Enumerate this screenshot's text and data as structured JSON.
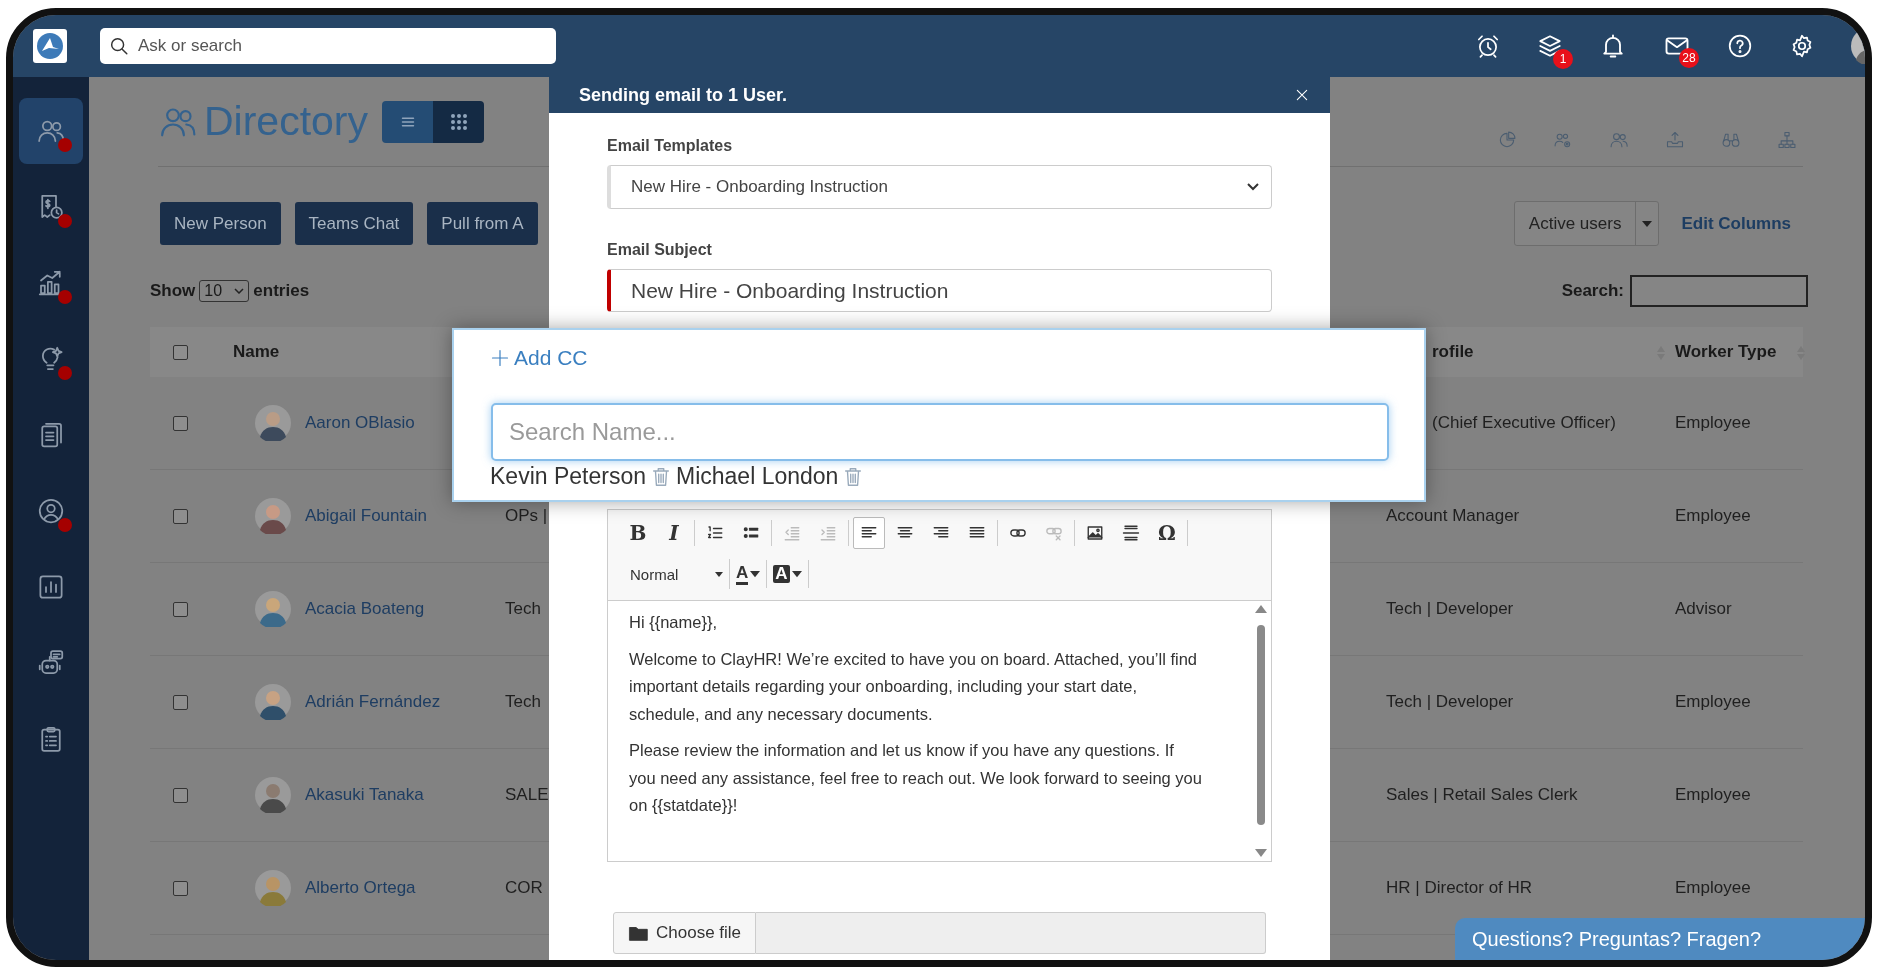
{
  "topbar": {
    "search": {
      "placeholder": "Ask or search"
    },
    "layers_badge": "1",
    "mail_badge": "28"
  },
  "sidebar": {
    "items": [
      {
        "selected": true,
        "alert": true
      },
      {
        "selected": false,
        "alert": true
      },
      {
        "selected": false,
        "alert": true
      },
      {
        "selected": false,
        "alert": true
      },
      {
        "selected": false,
        "alert": false
      },
      {
        "selected": false,
        "alert": true
      },
      {
        "selected": false,
        "alert": false
      },
      {
        "selected": false,
        "alert": false
      },
      {
        "selected": false,
        "alert": false
      }
    ]
  },
  "directory": {
    "title": "Directory",
    "view_toggle": [
      {
        "selected": true
      },
      {
        "selected": false
      }
    ],
    "buttons": [
      "New Person",
      "Teams Chat",
      "Pull from A"
    ],
    "filter": "Active users",
    "edit_columns": "Edit Columns",
    "show_label": "Show",
    "page_size": "10",
    "entries_label": "entries",
    "search_label": "Search:"
  },
  "table": {
    "select_all_checked": false,
    "columns": [
      "Name",
      "rofile",
      "Worker Type"
    ],
    "rows": [
      {
        "checked": false,
        "name": "Aaron OBlasio",
        "profile": "(Chief Executive Officer)",
        "worker_type": "Employee"
      },
      {
        "checked": false,
        "name": "Abigail Fountain",
        "column_3": "OPs |",
        "profile": "Account Manager",
        "worker_type": "Employee"
      },
      {
        "checked": false,
        "name": "Acacia Boateng",
        "column_3": "Tech",
        "profile": "Tech | Developer",
        "worker_type": "Advisor"
      },
      {
        "checked": false,
        "name": "Adrián Fernández",
        "column_3": "Tech",
        "profile": "Tech | Developer",
        "worker_type": "Employee"
      },
      {
        "checked": false,
        "name": "Akasuki Tanaka",
        "column_3": "SALE",
        "profile": "Sales | Retail Sales Clerk",
        "worker_type": "Employee"
      },
      {
        "checked": false,
        "name": "Alberto Ortega",
        "column_3": "COR",
        "profile": "HR | Director of HR",
        "worker_type": "Employee"
      }
    ]
  },
  "modal": {
    "title": "Sending email to 1 User.",
    "template_label": "Email Templates",
    "template_value": "New Hire - Onboarding Instruction",
    "subject_label": "Email Subject",
    "subject_value": "New Hire - Onboarding Instruction",
    "subject_invalid": true,
    "toolbar": {
      "groups": [
        [
          {
            "kind": "bold",
            "label": "B",
            "selected": false,
            "disabled": false
          },
          {
            "kind": "italic",
            "label": "I",
            "selected": false,
            "disabled": false
          }
        ],
        [
          {
            "kind": "numbered-list",
            "selected": false,
            "disabled": false
          },
          {
            "kind": "bulleted-list",
            "selected": false,
            "disabled": false
          }
        ],
        [
          {
            "kind": "outdent",
            "selected": false,
            "disabled": true
          },
          {
            "kind": "indent",
            "selected": false,
            "disabled": true
          }
        ],
        [
          {
            "kind": "align-left",
            "selected": true,
            "disabled": false
          },
          {
            "kind": "align-center",
            "selected": false,
            "disabled": false
          },
          {
            "kind": "align-right",
            "selected": false,
            "disabled": false
          },
          {
            "kind": "justify",
            "selected": false,
            "disabled": false
          }
        ],
        [
          {
            "kind": "link",
            "selected": false,
            "disabled": false
          },
          {
            "kind": "unlink",
            "selected": false,
            "disabled": true
          }
        ],
        [
          {
            "kind": "image",
            "selected": false,
            "disabled": false
          },
          {
            "kind": "horizontal-rule",
            "selected": false,
            "disabled": false
          },
          {
            "kind": "special-char",
            "label": "Ω",
            "selected": false,
            "disabled": false
          }
        ]
      ],
      "format": "Normal",
      "color_buttons": [
        {
          "kind": "text-color",
          "label": "A"
        },
        {
          "kind": "background-color",
          "label": "A"
        }
      ]
    },
    "body": [
      [
        "Hi {{name}},"
      ],
      [
        "Welcome to ClayHR! We’re excited to have you on board. Attached, you’ll find",
        "important details regarding your onboarding, including your start date,",
        "schedule, and any necessary documents."
      ],
      [
        "Please review the information and let us know if you have any questions. If",
        "you need any assistance, feel free to reach out. We look forward to seeing you",
        "on {{statdate}}!"
      ]
    ],
    "file_button": "Choose file"
  },
  "cc": {
    "add_label": "Add CC",
    "search": {
      "placeholder": "Search Name..."
    },
    "recipients": [
      "Kevin Peterson",
      "Michael London"
    ]
  },
  "chat": {
    "label": "Questions? Preguntas? Fragen?"
  }
}
